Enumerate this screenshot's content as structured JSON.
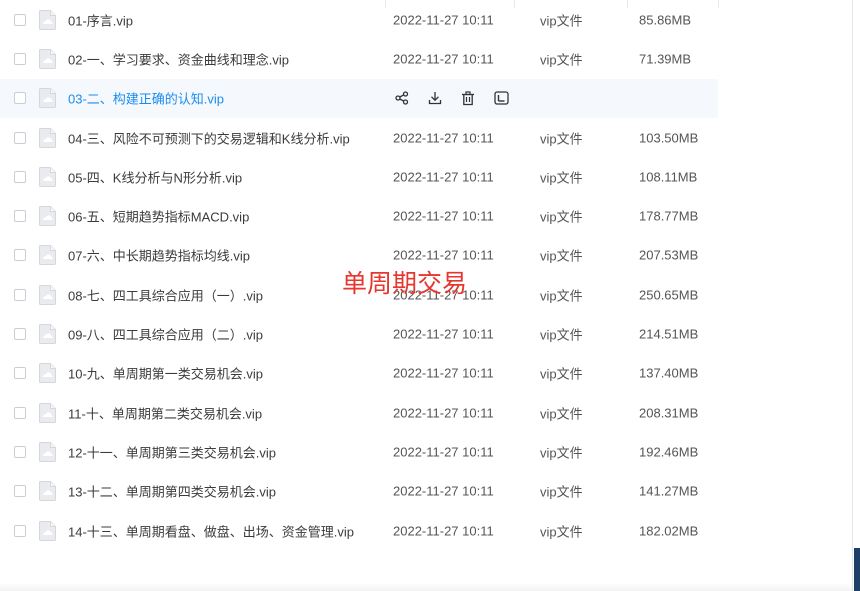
{
  "files": [
    {
      "name": "01-序言.vip",
      "date": "2022-11-27 10:11",
      "type": "vip文件",
      "size": "85.86MB"
    },
    {
      "name": "02-一、学习要求、资金曲线和理念.vip",
      "date": "2022-11-27 10:11",
      "type": "vip文件",
      "size": "71.39MB"
    },
    {
      "name": "03-二、构建正确的认知.vip",
      "date": "",
      "type": "",
      "size": "",
      "hovered": true
    },
    {
      "name": "04-三、风险不可预测下的交易逻辑和K线分析.vip",
      "date": "2022-11-27 10:11",
      "type": "vip文件",
      "size": "103.50MB"
    },
    {
      "name": "05-四、K线分析与N形分析.vip",
      "date": "2022-11-27 10:11",
      "type": "vip文件",
      "size": "108.11MB"
    },
    {
      "name": "06-五、短期趋势指标MACD.vip",
      "date": "2022-11-27 10:11",
      "type": "vip文件",
      "size": "178.77MB"
    },
    {
      "name": "07-六、中长期趋势指标均线.vip",
      "date": "2022-11-27 10:11",
      "type": "vip文件",
      "size": "207.53MB"
    },
    {
      "name": "08-七、四工具综合应用（一）.vip",
      "date": "2022-11-27 10:11",
      "type": "vip文件",
      "size": "250.65MB"
    },
    {
      "name": "09-八、四工具综合应用（二）.vip",
      "date": "2022-11-27 10:11",
      "type": "vip文件",
      "size": "214.51MB"
    },
    {
      "name": "10-九、单周期第一类交易机会.vip",
      "date": "2022-11-27 10:11",
      "type": "vip文件",
      "size": "137.40MB"
    },
    {
      "name": "11-十、单周期第二类交易机会.vip",
      "date": "2022-11-27 10:11",
      "type": "vip文件",
      "size": "208.31MB"
    },
    {
      "name": "12-十一、单周期第三类交易机会.vip",
      "date": "2022-11-27 10:11",
      "type": "vip文件",
      "size": "192.46MB"
    },
    {
      "name": "13-十二、单周期第四类交易机会.vip",
      "date": "2022-11-27 10:11",
      "type": "vip文件",
      "size": "141.27MB"
    },
    {
      "name": "14-十三、单周期看盘、做盘、出场、资金管理.vip",
      "date": "2022-11-27 10:11",
      "type": "vip文件",
      "size": "182.02MB"
    }
  ],
  "hover_actions": [
    "share-icon",
    "download-icon",
    "delete-icon",
    "more-icon"
  ],
  "watermark": "单周期交易",
  "colors": {
    "accent": "#1a8cf0",
    "watermark": "#e5372d",
    "hover_bg": "#f5f8fc",
    "text": "#3b3b3b"
  }
}
